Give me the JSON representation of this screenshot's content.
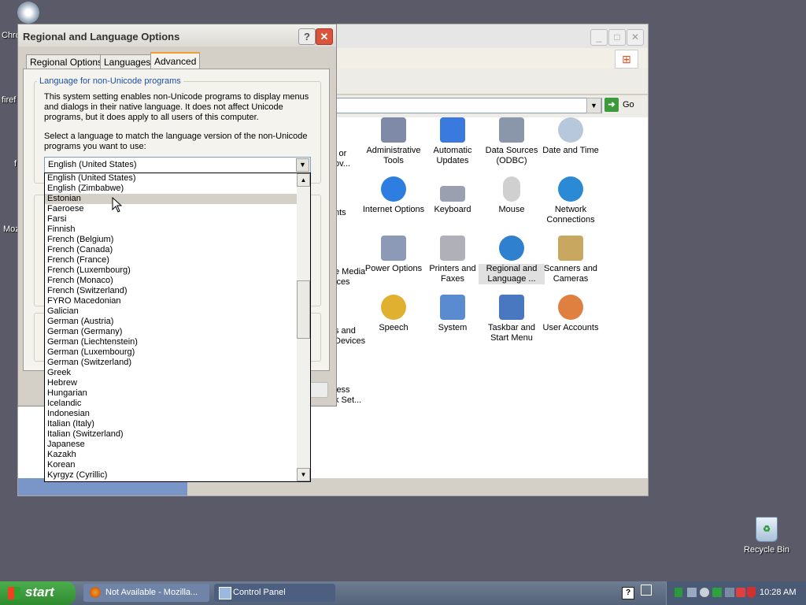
{
  "desktop": {
    "left_labels": [
      "Chro",
      "firef",
      "f",
      "Moz"
    ],
    "recycle_bin": "Recycle Bin"
  },
  "control_panel": {
    "go_label": "Go",
    "partial_items": [
      {
        "lines": [
          "l or",
          "ov..."
        ]
      },
      {
        "lines": [
          "nts"
        ]
      },
      {
        "lines": [
          "e Media",
          "ices"
        ]
      },
      {
        "lines": [
          "s and",
          "Devices"
        ]
      },
      {
        "lines": [
          "less",
          "k Set..."
        ]
      }
    ],
    "items": [
      {
        "label": "Administrative Tools",
        "icon": "administrative-tools-icon",
        "color": "#7e8aa8"
      },
      {
        "label": "Automatic Updates",
        "icon": "automatic-updates-icon",
        "color": "#3a7adf"
      },
      {
        "label": "Data Sources (ODBC)",
        "icon": "data-sources-icon",
        "color": "#8a96aa"
      },
      {
        "label": "Date and Time",
        "icon": "date-time-icon",
        "color": "#b8c8dc"
      },
      {
        "label": "Internet Options",
        "icon": "internet-options-icon",
        "color": "#2e7de0"
      },
      {
        "label": "Keyboard",
        "icon": "keyboard-icon",
        "color": "#9aa0b0"
      },
      {
        "label": "Mouse",
        "icon": "mouse-icon",
        "color": "#d0d0d0"
      },
      {
        "label": "Network Connections",
        "icon": "network-connections-icon",
        "color": "#2a8ad6"
      },
      {
        "label": "Power Options",
        "icon": "power-options-icon",
        "color": "#8c9ab8"
      },
      {
        "label": "Printers and Faxes",
        "icon": "printers-faxes-icon",
        "color": "#b0b0b8"
      },
      {
        "label": "Regional and Language ...",
        "icon": "regional-language-icon",
        "color": "#3080d0"
      },
      {
        "label": "Scanners and Cameras",
        "icon": "scanners-cameras-icon",
        "color": "#c8a860"
      },
      {
        "label": "Speech",
        "icon": "speech-icon",
        "color": "#e0b030"
      },
      {
        "label": "System",
        "icon": "system-icon",
        "color": "#5a8ad0"
      },
      {
        "label": "Taskbar and Start Menu",
        "icon": "taskbar-start-menu-icon",
        "color": "#4a78c0"
      },
      {
        "label": "User Accounts",
        "icon": "user-accounts-icon",
        "color": "#e08040"
      }
    ]
  },
  "dialog": {
    "title": "Regional and Language Options",
    "help": "?",
    "close": "✕",
    "tabs": [
      "Regional Options",
      "Languages",
      "Advanced"
    ],
    "active_tab": "Advanced",
    "group_title": "Language for non-Unicode programs",
    "description": [
      "This system setting enables non-Unicode programs to display menus",
      "and dialogs in their native language. It does not affect Unicode",
      "programs, but it does apply to all users of this computer."
    ],
    "select_prompt": [
      "Select a language to match the language version of the non-Unicode",
      "programs you want to use:"
    ],
    "selected_language": "English (United States)",
    "highlighted_option": "Estonian",
    "options": [
      "English (United States)",
      "English (Zimbabwe)",
      "Estonian",
      "Faeroese",
      "Farsi",
      "Finnish",
      "French (Belgium)",
      "French (Canada)",
      "French (France)",
      "French (Luxembourg)",
      "French (Monaco)",
      "French (Switzerland)",
      "FYRO Macedonian",
      "Galician",
      "German (Austria)",
      "German (Germany)",
      "German (Liechtenstein)",
      "German (Luxembourg)",
      "German (Switzerland)",
      "Greek",
      "Hebrew",
      "Hungarian",
      "Icelandic",
      "Indonesian",
      "Italian (Italy)",
      "Italian (Switzerland)",
      "Japanese",
      "Kazakh",
      "Korean",
      "Kyrgyz (Cyrillic)"
    ]
  },
  "taskbar": {
    "start": "start",
    "tasks": [
      {
        "label": "Not Available - Mozilla...",
        "icon": "firefox-icon",
        "active": false
      },
      {
        "label": "Control Panel",
        "icon": "control-panel-icon",
        "active": true
      }
    ],
    "clock": "10:28 AM",
    "help_glyph": "?"
  },
  "colors": {
    "desktop": "#5a5a68",
    "highlight": "#d4d0c8",
    "group_title": "#1f4fa8",
    "active_tab_accent": "#f0a030"
  }
}
